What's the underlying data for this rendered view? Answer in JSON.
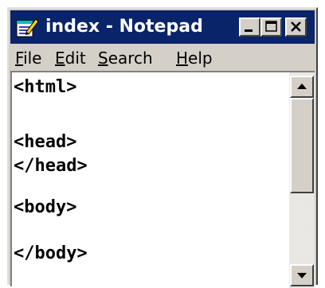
{
  "window": {
    "title": "index - Notepad",
    "app_icon": "notepad-icon",
    "controls": [
      "minimize-icon",
      "maximize-icon",
      "close-icon"
    ]
  },
  "menu": {
    "file": {
      "mnemonic": "F",
      "rest": "ile"
    },
    "edit": {
      "mnemonic": "E",
      "rest": "dit"
    },
    "search": {
      "mnemonic": "S",
      "rest": "earch"
    },
    "help": {
      "mnemonic": "H",
      "rest": "elp"
    }
  },
  "editor": {
    "lines": [
      "<html>",
      "",
      "<head>",
      "</head>",
      "",
      "<body>",
      "",
      "</body>"
    ]
  },
  "colors": {
    "titlebar": "#0a246a",
    "chrome": "#d4d0c8",
    "editor_bg": "#ffffff"
  }
}
